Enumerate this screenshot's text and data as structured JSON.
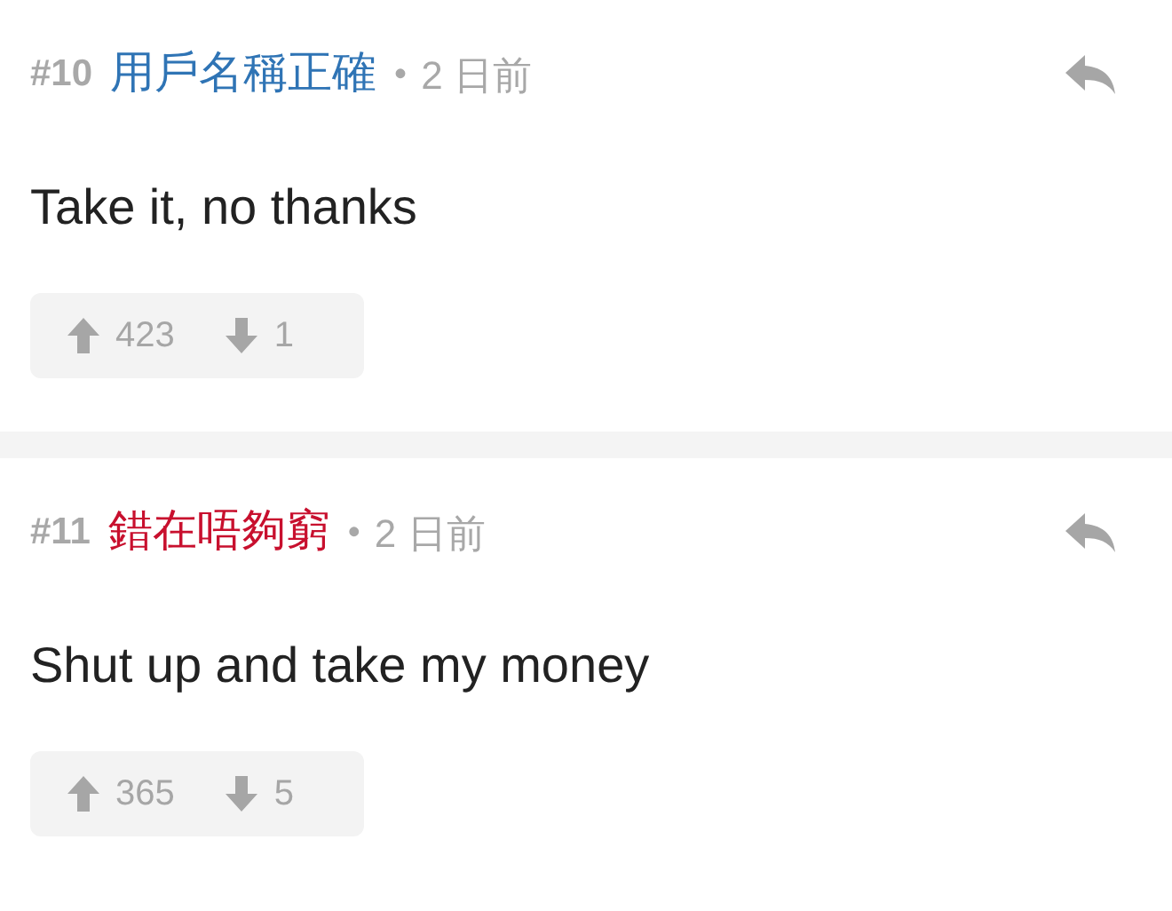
{
  "comments": [
    {
      "number": "#10",
      "username": "用戶名稱正確",
      "color": "#2f74b5",
      "separator": "•",
      "time": "2 日前",
      "body": "Take it, no thanks",
      "upvotes": "423",
      "downvotes": "1"
    },
    {
      "number": "#11",
      "username": "錯在唔夠窮",
      "color": "#c8102e",
      "separator": "•",
      "time": "2 日前",
      "body": "Shut up and take my money",
      "upvotes": "365",
      "downvotes": "5"
    }
  ]
}
